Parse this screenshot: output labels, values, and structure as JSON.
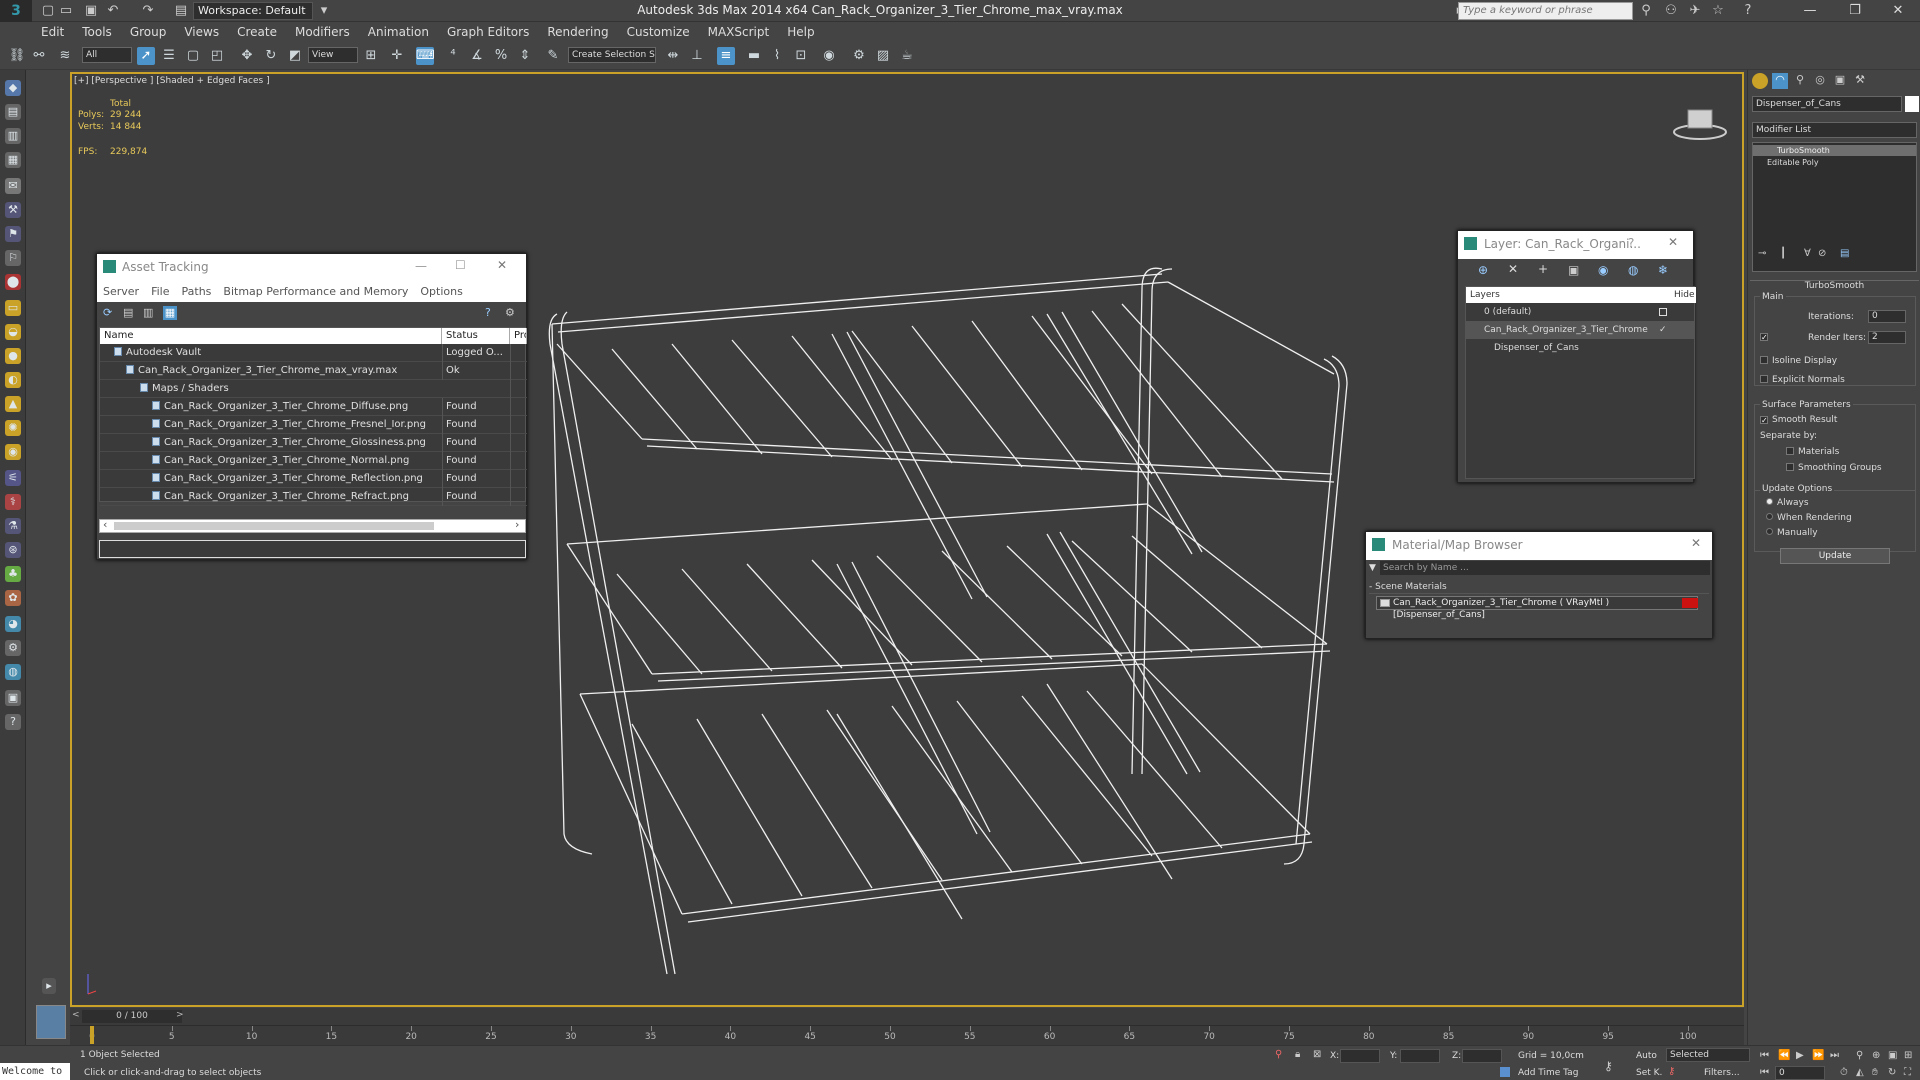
{
  "titlebar": {
    "workspace": "Workspace: Default",
    "window_title": "Autodesk 3ds Max  2014 x64      Can_Rack_Organizer_3_Tier_Chrome_max_vray.max",
    "search_placeholder": "Type a keyword or phrase"
  },
  "menu": [
    "Edit",
    "Tools",
    "Group",
    "Views",
    "Create",
    "Modifiers",
    "Animation",
    "Graph Editors",
    "Rendering",
    "Customize",
    "MAXScript",
    "Help"
  ],
  "toolbar": {
    "selection_filter": "All",
    "ref_coord": "View",
    "named_selection": "Create Selection S"
  },
  "viewport": {
    "label": "[+] [Perspective ] [Shaded + Edged Faces ]",
    "stats_total": "Total",
    "polys_label": "Polys:",
    "polys_value": "29 244",
    "verts_label": "Verts:",
    "verts_value": "14 844",
    "fps_label": "FPS:",
    "fps_value": "229,874"
  },
  "asset_tracking": {
    "title": "Asset Tracking",
    "menu": [
      "Server",
      "File",
      "Paths",
      "Bitmap Performance and Memory",
      "Options"
    ],
    "columns": [
      "Name",
      "Status",
      "Pro"
    ],
    "rows": [
      {
        "name": "Autodesk Vault",
        "status": "Logged O...",
        "indent": 14
      },
      {
        "name": "Can_Rack_Organizer_3_Tier_Chrome_max_vray.max",
        "status": "Ok",
        "indent": 26
      },
      {
        "name": "Maps / Shaders",
        "status": "",
        "indent": 40
      },
      {
        "name": "Can_Rack_Organizer_3_Tier_Chrome_Diffuse.png",
        "status": "Found",
        "indent": 52
      },
      {
        "name": "Can_Rack_Organizer_3_Tier_Chrome_Fresnel_Ior.png",
        "status": "Found",
        "indent": 52
      },
      {
        "name": "Can_Rack_Organizer_3_Tier_Chrome_Glossiness.png",
        "status": "Found",
        "indent": 52
      },
      {
        "name": "Can_Rack_Organizer_3_Tier_Chrome_Normal.png",
        "status": "Found",
        "indent": 52
      },
      {
        "name": "Can_Rack_Organizer_3_Tier_Chrome_Reflection.png",
        "status": "Found",
        "indent": 52
      },
      {
        "name": "Can_Rack_Organizer_3_Tier_Chrome_Refract.png",
        "status": "Found",
        "indent": 52
      }
    ]
  },
  "layer_dialog": {
    "title": "Layer: Can_Rack_Organi...",
    "col_layers": "Layers",
    "col_hide": "Hide",
    "rows": [
      "0 (default)",
      "Can_Rack_Organizer_3_Tier_Chrome",
      "Dispenser_of_Cans"
    ]
  },
  "material_browser": {
    "title": "Material/Map Browser",
    "search_placeholder": "Search by Name ...",
    "section": "- Scene Materials",
    "material": "Can_Rack_Organizer_3_Tier_Chrome ( VRayMtl ) [Dispenser_of_Cans]",
    "swatch_color": "#cc1111"
  },
  "command_panel": {
    "object_name": "Dispenser_of_Cans",
    "modifier_list": "Modifier List",
    "stack": [
      "TurboSmooth",
      "Editable Poly"
    ],
    "rollout_title": "TurboSmooth",
    "main_group": "Main",
    "iterations_label": "Iterations:",
    "iterations_value": "0",
    "render_iters_label": "Render Iters:",
    "render_iters_value": "2",
    "isoline_label": "Isoline Display",
    "explicit_label": "Explicit Normals",
    "surface_group": "Surface Parameters",
    "smooth_result_label": "Smooth Result",
    "separate_by": "Separate by:",
    "materials_label": "Materials",
    "smoothing_groups_label": "Smoothing Groups",
    "update_group": "Update Options",
    "always_label": "Always",
    "when_rendering_label": "When Rendering",
    "manually_label": "Manually",
    "update_button": "Update"
  },
  "timeline": {
    "frame_counter": "0 / 100",
    "ticks": [
      "0",
      "5",
      "10",
      "15",
      "20",
      "25",
      "30",
      "35",
      "40",
      "45",
      "50",
      "55",
      "60",
      "65",
      "70",
      "75",
      "80",
      "85",
      "90",
      "95",
      "100"
    ]
  },
  "statusbar": {
    "maxscript": "Welcome to",
    "selection_info": "1 Object Selected",
    "prompt": "Click or click-and-drag to select objects",
    "x_label": "X:",
    "y_label": "Y:",
    "z_label": "Z:",
    "grid": "Grid = 10,0cm",
    "auto": "Auto",
    "selected": "Selected",
    "set_key": "Set K.",
    "filters": "Filters...",
    "add_time_tag": "Add Time Tag",
    "frame_field": "0"
  },
  "colors": {
    "active_viewport_border": "#c9a227",
    "accent_blue": "#4b93c8",
    "wireframe": "#ffffff"
  }
}
